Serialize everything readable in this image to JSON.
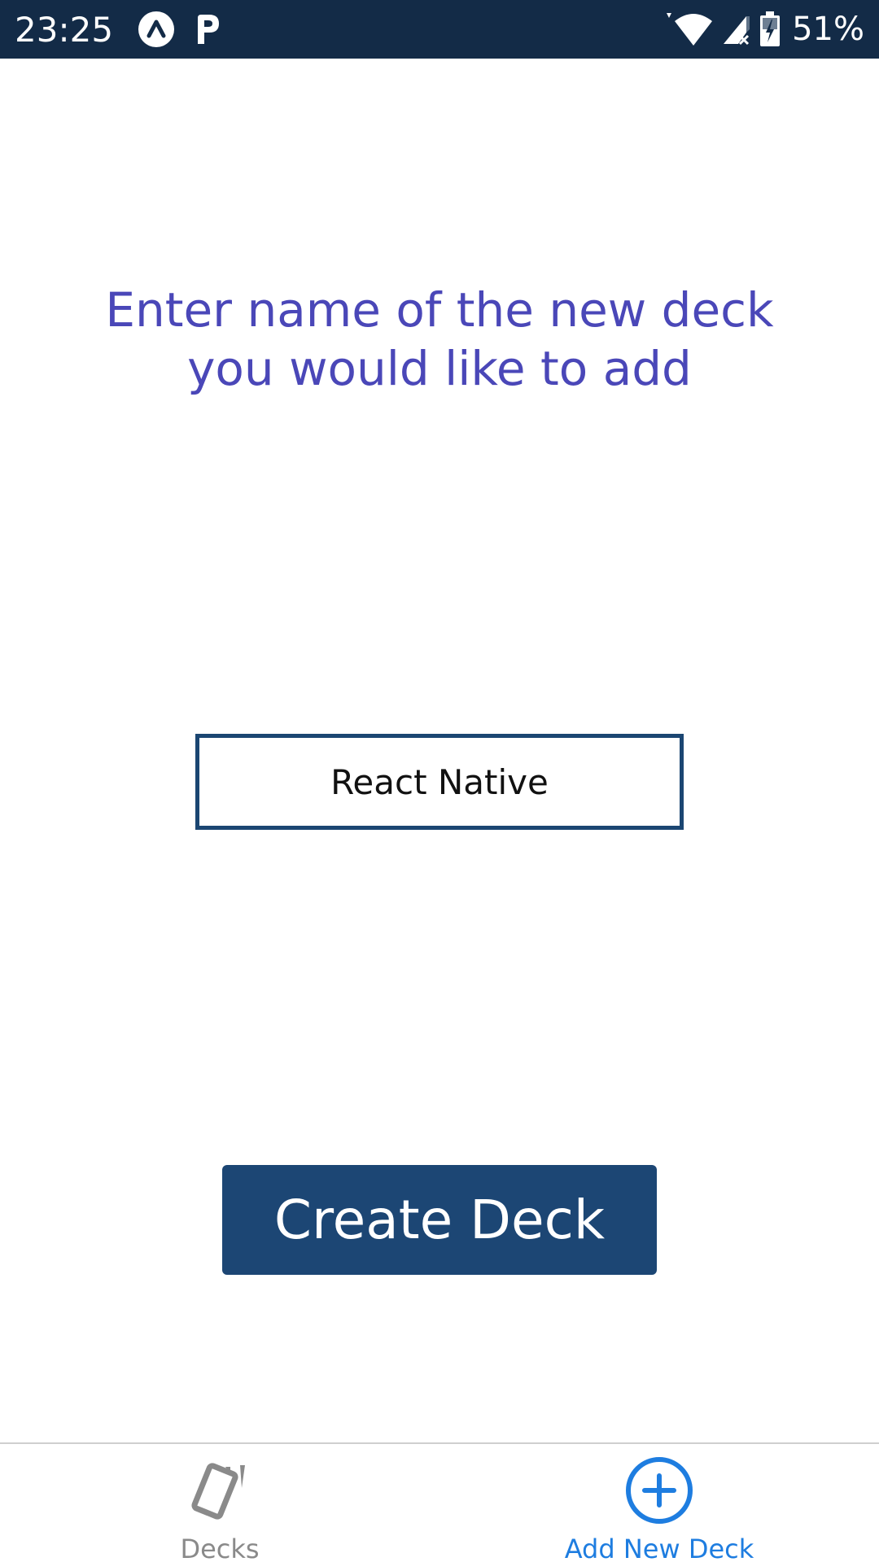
{
  "status_bar": {
    "time": "23:25",
    "battery": "51%",
    "icons": [
      "expo-icon",
      "p-icon",
      "wifi-icon",
      "signal-icon",
      "battery-icon"
    ],
    "background": "#132b47"
  },
  "prompt": {
    "line1": "Enter name of the new deck",
    "line2": "you would like to add",
    "color": "#4a47b8"
  },
  "deck_input": {
    "value": "React Native",
    "border_color": "#1b4672"
  },
  "create_button": {
    "label": "Create Deck",
    "background": "#1c4674"
  },
  "tabs": [
    {
      "label": "Decks",
      "icon": "cards-icon",
      "active": false
    },
    {
      "label": "Add New Deck",
      "icon": "plus-circle-icon",
      "active": true
    }
  ],
  "colors": {
    "tab_active": "#1e7de0",
    "tab_inactive": "#8a8a8a"
  }
}
